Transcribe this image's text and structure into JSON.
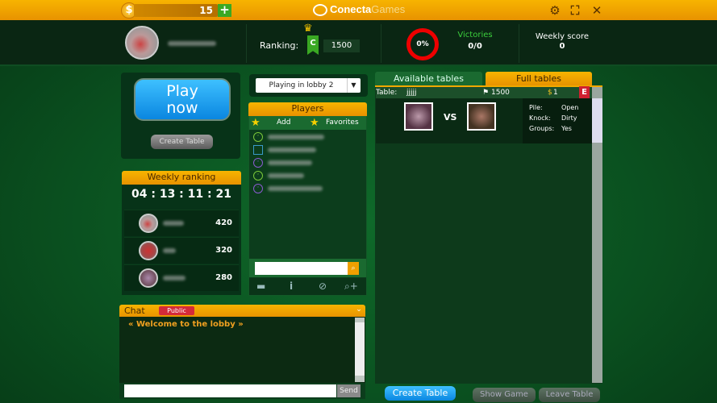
{
  "topbar": {
    "coin_symbol": "$",
    "balance": "15",
    "add_label": "+",
    "logo_primary": "Conecta",
    "logo_secondary": "Games",
    "icons": [
      "gear-icon",
      "fullscreen-icon",
      "close-icon"
    ]
  },
  "header": {
    "ranking_label": "Ranking:",
    "ranking_badge": "C",
    "ranking_value": "1500",
    "win_percent": "0%",
    "victories_label": "Victories",
    "victories_value": "0/0",
    "weekly_score_label": "Weekly score",
    "weekly_score_value": "0"
  },
  "play": {
    "play_now_line1": "Play",
    "play_now_line2": "now",
    "create_table": "Create Table"
  },
  "weekly_ranking": {
    "title": "Weekly ranking",
    "countdown": "04 : 13 : 11 : 21",
    "rows": [
      {
        "score": "420"
      },
      {
        "score": "320"
      },
      {
        "score": "280"
      }
    ]
  },
  "lobby": {
    "selected": "Playing in lobby 2"
  },
  "players": {
    "title": "Players",
    "add": "Add",
    "favorites": "Favorites",
    "search_placeholder": ""
  },
  "tables": {
    "tabs": [
      {
        "label": "Available tables"
      },
      {
        "label": "Full tables"
      }
    ],
    "active_tab": "Full tables",
    "rows": [
      {
        "table_label": "Table:",
        "name": "jjjjj",
        "points": "1500",
        "stake_symbol": "$",
        "stake": "1",
        "badge": "E",
        "vs": "VS",
        "pile_label": "Pile:",
        "pile": "Open",
        "knock_label": "Knock:",
        "knock": "Dirty",
        "groups_label": "Groups:",
        "groups": "Yes"
      }
    ]
  },
  "chat": {
    "title": "Chat",
    "channel": "Public",
    "welcome": "« Welcome to the lobby »",
    "send": "Send",
    "input_value": ""
  },
  "bottom": {
    "create_table": "Create Table",
    "show_game": "Show Game",
    "leave_table": "Leave Table"
  },
  "colors": {
    "accent_orange": "#f7b400",
    "play_blue": "#1aa0f0",
    "victories_green": "#3ccf3c",
    "ring_red": "#ee0000",
    "stake_gold": "#f0c020"
  }
}
